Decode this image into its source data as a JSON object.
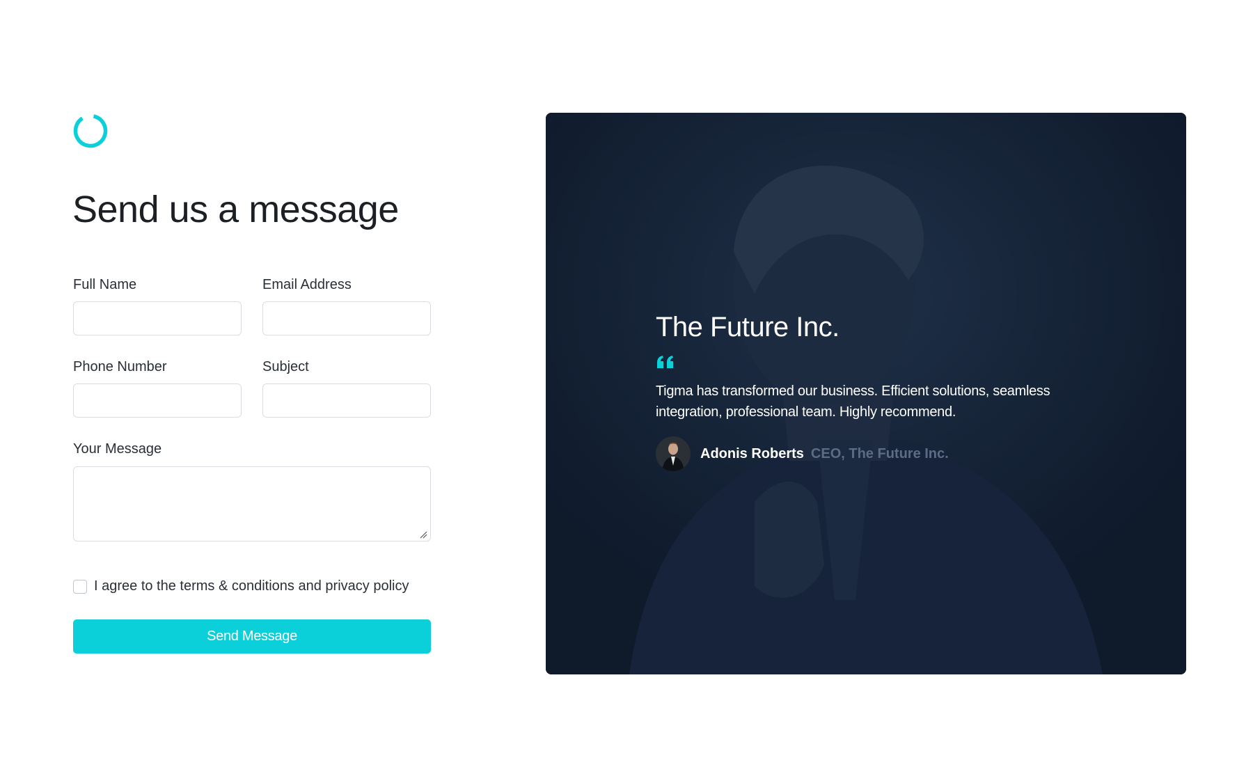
{
  "logo": {
    "icon": "ring-logo-icon",
    "color": "#0bd0da"
  },
  "form": {
    "heading": "Send us a message",
    "fields": {
      "full_name": {
        "label": "Full Name",
        "value": "",
        "placeholder": ""
      },
      "email": {
        "label": "Email Address",
        "value": "",
        "placeholder": ""
      },
      "phone": {
        "label": "Phone Number",
        "value": "",
        "placeholder": ""
      },
      "subject": {
        "label": "Subject",
        "value": "",
        "placeholder": ""
      },
      "message": {
        "label": "Your Message",
        "value": "",
        "placeholder": ""
      }
    },
    "agree_label": "I agree to the terms & conditions and privacy policy",
    "agree_checked": false,
    "submit_label": "Send Message",
    "accent_color": "#0bd0da"
  },
  "testimonial": {
    "company": "The Future Inc.",
    "quote_icon": "quote-icon",
    "quote": "Tigma has transformed our business. Efficient solutions, seamless integration, professional team. Highly recommend.",
    "author_name": "Adonis Roberts",
    "author_role": "CEO, The Future Inc.",
    "background_color": "#0f1a2b"
  }
}
